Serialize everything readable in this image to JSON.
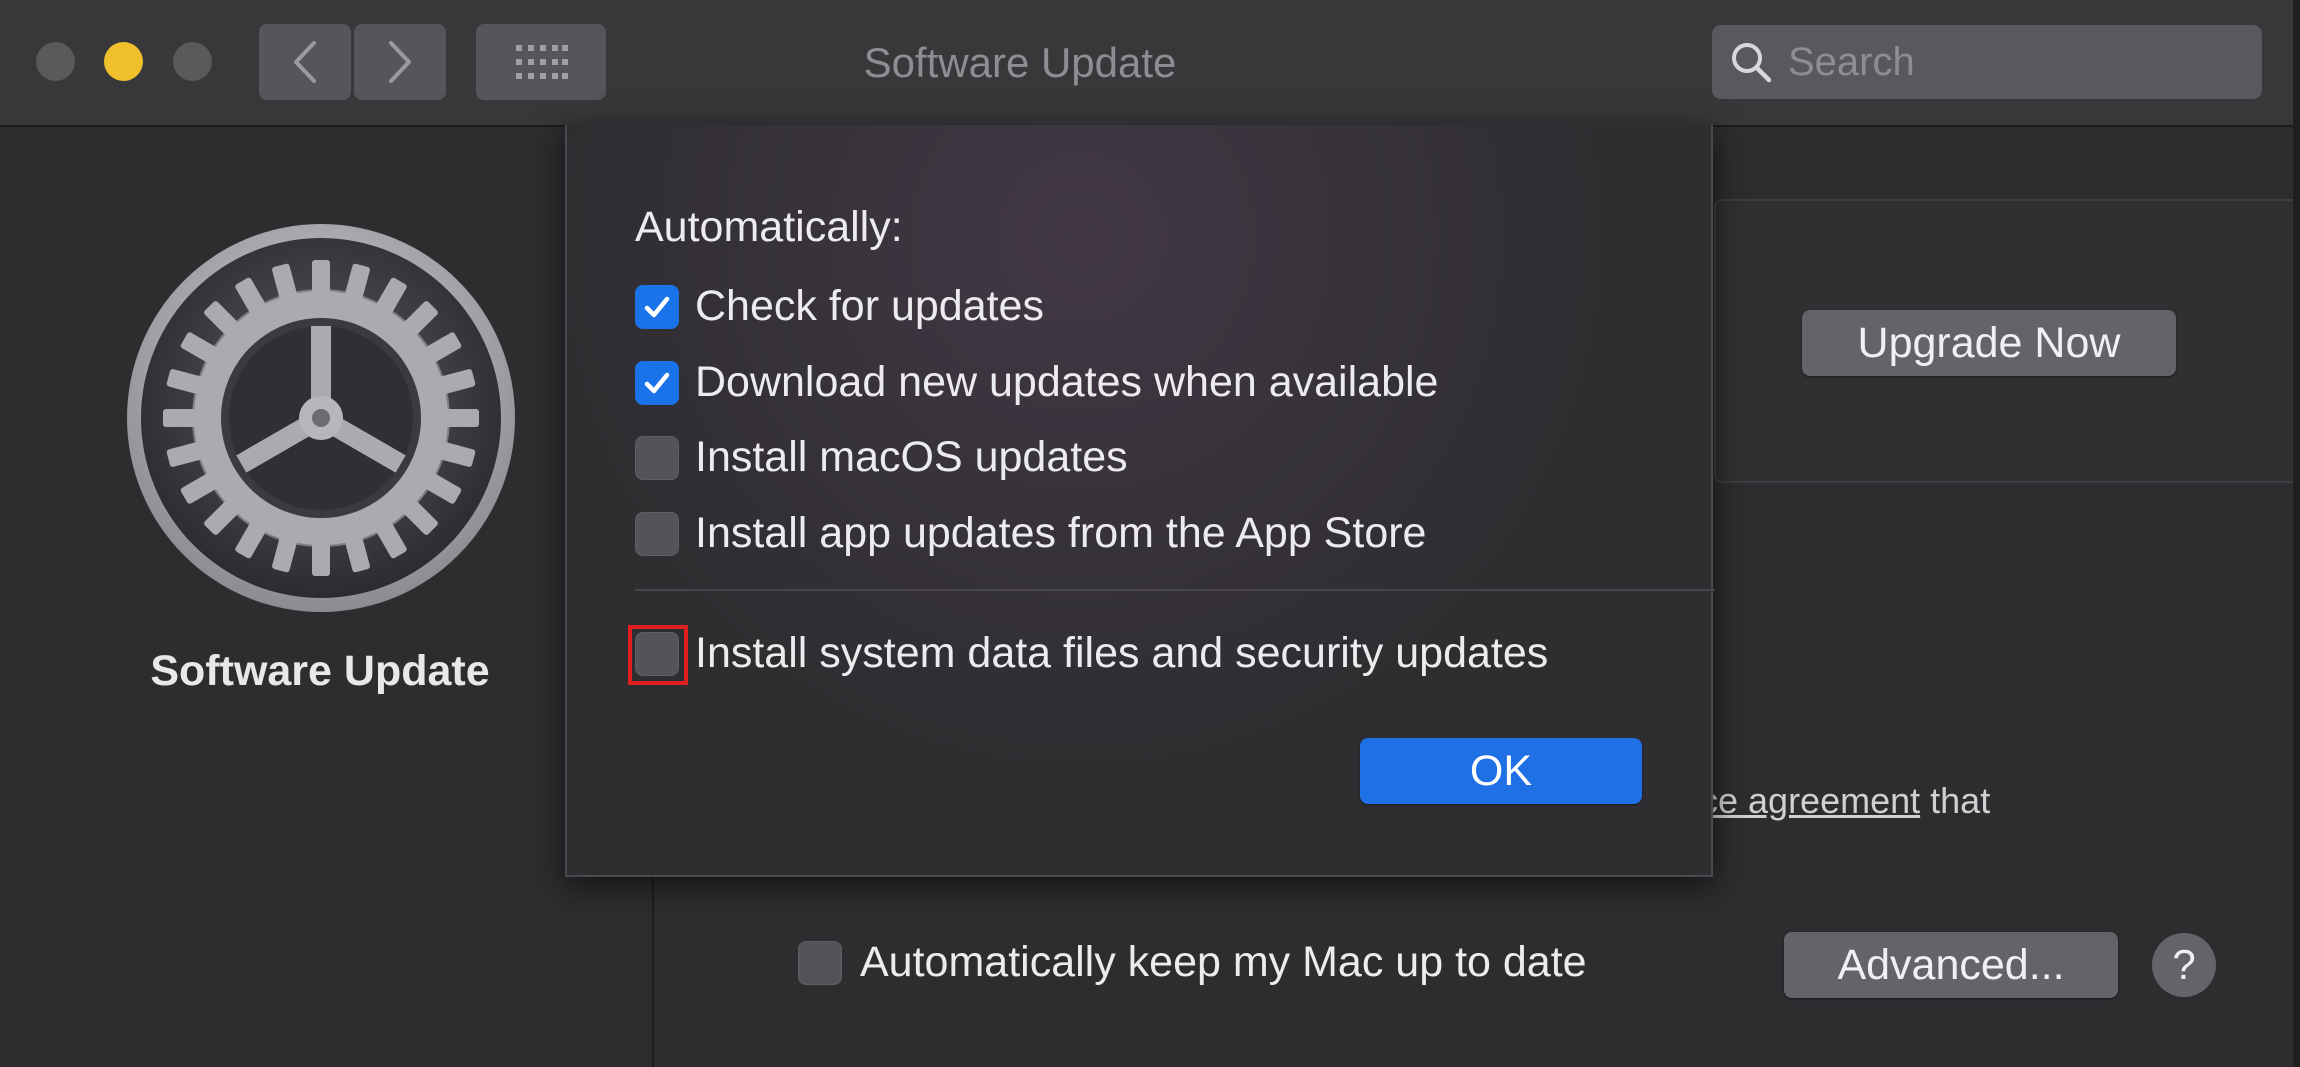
{
  "window": {
    "title": "Software Update"
  },
  "toolbar": {
    "search_placeholder": "Search"
  },
  "left_pane": {
    "label": "Software Update",
    "icon": "gear-icon"
  },
  "background": {
    "upgrade_button": "Upgrade Now",
    "license_text_link": "ce agreement",
    "license_text_tail": " that",
    "auto_keep_label": "Automatically keep my Mac up to date",
    "auto_keep_checked": false,
    "advanced_button": "Advanced...",
    "help_button": "?"
  },
  "sheet": {
    "heading": "Automatically:",
    "options": [
      {
        "label": "Check for updates",
        "checked": true
      },
      {
        "label": "Download new updates when available",
        "checked": true
      },
      {
        "label": "Install macOS updates",
        "checked": false
      },
      {
        "label": "Install app updates from the App Store",
        "checked": false
      },
      {
        "label": "Install system data files and security updates",
        "checked": false
      }
    ],
    "ok_button": "OK"
  },
  "colors": {
    "accent": "#1f6fe5",
    "checkbox_checked": "#1a73e8",
    "highlight": "#e02020",
    "minimize": "#f0c02c"
  }
}
